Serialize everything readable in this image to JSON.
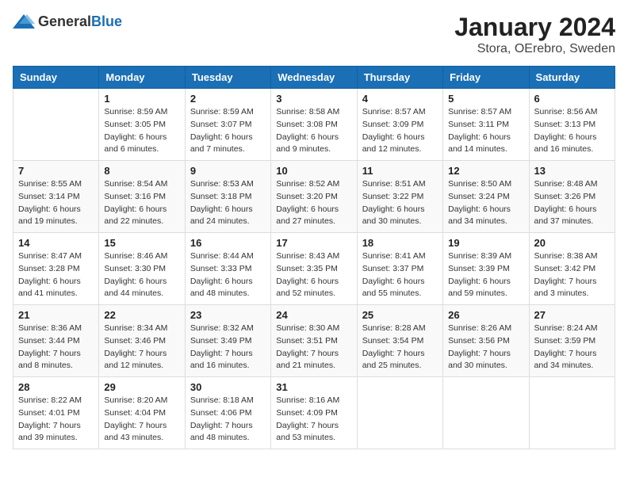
{
  "logo": {
    "general": "General",
    "blue": "Blue"
  },
  "title": "January 2024",
  "subtitle": "Stora, OErebro, Sweden",
  "weekdays": [
    "Sunday",
    "Monday",
    "Tuesday",
    "Wednesday",
    "Thursday",
    "Friday",
    "Saturday"
  ],
  "weeks": [
    [
      {
        "day": null,
        "sunrise": null,
        "sunset": null,
        "daylight": null
      },
      {
        "day": "1",
        "sunrise": "Sunrise: 8:59 AM",
        "sunset": "Sunset: 3:05 PM",
        "daylight": "Daylight: 6 hours and 6 minutes."
      },
      {
        "day": "2",
        "sunrise": "Sunrise: 8:59 AM",
        "sunset": "Sunset: 3:07 PM",
        "daylight": "Daylight: 6 hours and 7 minutes."
      },
      {
        "day": "3",
        "sunrise": "Sunrise: 8:58 AM",
        "sunset": "Sunset: 3:08 PM",
        "daylight": "Daylight: 6 hours and 9 minutes."
      },
      {
        "day": "4",
        "sunrise": "Sunrise: 8:57 AM",
        "sunset": "Sunset: 3:09 PM",
        "daylight": "Daylight: 6 hours and 12 minutes."
      },
      {
        "day": "5",
        "sunrise": "Sunrise: 8:57 AM",
        "sunset": "Sunset: 3:11 PM",
        "daylight": "Daylight: 6 hours and 14 minutes."
      },
      {
        "day": "6",
        "sunrise": "Sunrise: 8:56 AM",
        "sunset": "Sunset: 3:13 PM",
        "daylight": "Daylight: 6 hours and 16 minutes."
      }
    ],
    [
      {
        "day": "7",
        "sunrise": "Sunrise: 8:55 AM",
        "sunset": "Sunset: 3:14 PM",
        "daylight": "Daylight: 6 hours and 19 minutes."
      },
      {
        "day": "8",
        "sunrise": "Sunrise: 8:54 AM",
        "sunset": "Sunset: 3:16 PM",
        "daylight": "Daylight: 6 hours and 22 minutes."
      },
      {
        "day": "9",
        "sunrise": "Sunrise: 8:53 AM",
        "sunset": "Sunset: 3:18 PM",
        "daylight": "Daylight: 6 hours and 24 minutes."
      },
      {
        "day": "10",
        "sunrise": "Sunrise: 8:52 AM",
        "sunset": "Sunset: 3:20 PM",
        "daylight": "Daylight: 6 hours and 27 minutes."
      },
      {
        "day": "11",
        "sunrise": "Sunrise: 8:51 AM",
        "sunset": "Sunset: 3:22 PM",
        "daylight": "Daylight: 6 hours and 30 minutes."
      },
      {
        "day": "12",
        "sunrise": "Sunrise: 8:50 AM",
        "sunset": "Sunset: 3:24 PM",
        "daylight": "Daylight: 6 hours and 34 minutes."
      },
      {
        "day": "13",
        "sunrise": "Sunrise: 8:48 AM",
        "sunset": "Sunset: 3:26 PM",
        "daylight": "Daylight: 6 hours and 37 minutes."
      }
    ],
    [
      {
        "day": "14",
        "sunrise": "Sunrise: 8:47 AM",
        "sunset": "Sunset: 3:28 PM",
        "daylight": "Daylight: 6 hours and 41 minutes."
      },
      {
        "day": "15",
        "sunrise": "Sunrise: 8:46 AM",
        "sunset": "Sunset: 3:30 PM",
        "daylight": "Daylight: 6 hours and 44 minutes."
      },
      {
        "day": "16",
        "sunrise": "Sunrise: 8:44 AM",
        "sunset": "Sunset: 3:33 PM",
        "daylight": "Daylight: 6 hours and 48 minutes."
      },
      {
        "day": "17",
        "sunrise": "Sunrise: 8:43 AM",
        "sunset": "Sunset: 3:35 PM",
        "daylight": "Daylight: 6 hours and 52 minutes."
      },
      {
        "day": "18",
        "sunrise": "Sunrise: 8:41 AM",
        "sunset": "Sunset: 3:37 PM",
        "daylight": "Daylight: 6 hours and 55 minutes."
      },
      {
        "day": "19",
        "sunrise": "Sunrise: 8:39 AM",
        "sunset": "Sunset: 3:39 PM",
        "daylight": "Daylight: 6 hours and 59 minutes."
      },
      {
        "day": "20",
        "sunrise": "Sunrise: 8:38 AM",
        "sunset": "Sunset: 3:42 PM",
        "daylight": "Daylight: 7 hours and 3 minutes."
      }
    ],
    [
      {
        "day": "21",
        "sunrise": "Sunrise: 8:36 AM",
        "sunset": "Sunset: 3:44 PM",
        "daylight": "Daylight: 7 hours and 8 minutes."
      },
      {
        "day": "22",
        "sunrise": "Sunrise: 8:34 AM",
        "sunset": "Sunset: 3:46 PM",
        "daylight": "Daylight: 7 hours and 12 minutes."
      },
      {
        "day": "23",
        "sunrise": "Sunrise: 8:32 AM",
        "sunset": "Sunset: 3:49 PM",
        "daylight": "Daylight: 7 hours and 16 minutes."
      },
      {
        "day": "24",
        "sunrise": "Sunrise: 8:30 AM",
        "sunset": "Sunset: 3:51 PM",
        "daylight": "Daylight: 7 hours and 21 minutes."
      },
      {
        "day": "25",
        "sunrise": "Sunrise: 8:28 AM",
        "sunset": "Sunset: 3:54 PM",
        "daylight": "Daylight: 7 hours and 25 minutes."
      },
      {
        "day": "26",
        "sunrise": "Sunrise: 8:26 AM",
        "sunset": "Sunset: 3:56 PM",
        "daylight": "Daylight: 7 hours and 30 minutes."
      },
      {
        "day": "27",
        "sunrise": "Sunrise: 8:24 AM",
        "sunset": "Sunset: 3:59 PM",
        "daylight": "Daylight: 7 hours and 34 minutes."
      }
    ],
    [
      {
        "day": "28",
        "sunrise": "Sunrise: 8:22 AM",
        "sunset": "Sunset: 4:01 PM",
        "daylight": "Daylight: 7 hours and 39 minutes."
      },
      {
        "day": "29",
        "sunrise": "Sunrise: 8:20 AM",
        "sunset": "Sunset: 4:04 PM",
        "daylight": "Daylight: 7 hours and 43 minutes."
      },
      {
        "day": "30",
        "sunrise": "Sunrise: 8:18 AM",
        "sunset": "Sunset: 4:06 PM",
        "daylight": "Daylight: 7 hours and 48 minutes."
      },
      {
        "day": "31",
        "sunrise": "Sunrise: 8:16 AM",
        "sunset": "Sunset: 4:09 PM",
        "daylight": "Daylight: 7 hours and 53 minutes."
      },
      {
        "day": null,
        "sunrise": null,
        "sunset": null,
        "daylight": null
      },
      {
        "day": null,
        "sunrise": null,
        "sunset": null,
        "daylight": null
      },
      {
        "day": null,
        "sunrise": null,
        "sunset": null,
        "daylight": null
      }
    ]
  ]
}
